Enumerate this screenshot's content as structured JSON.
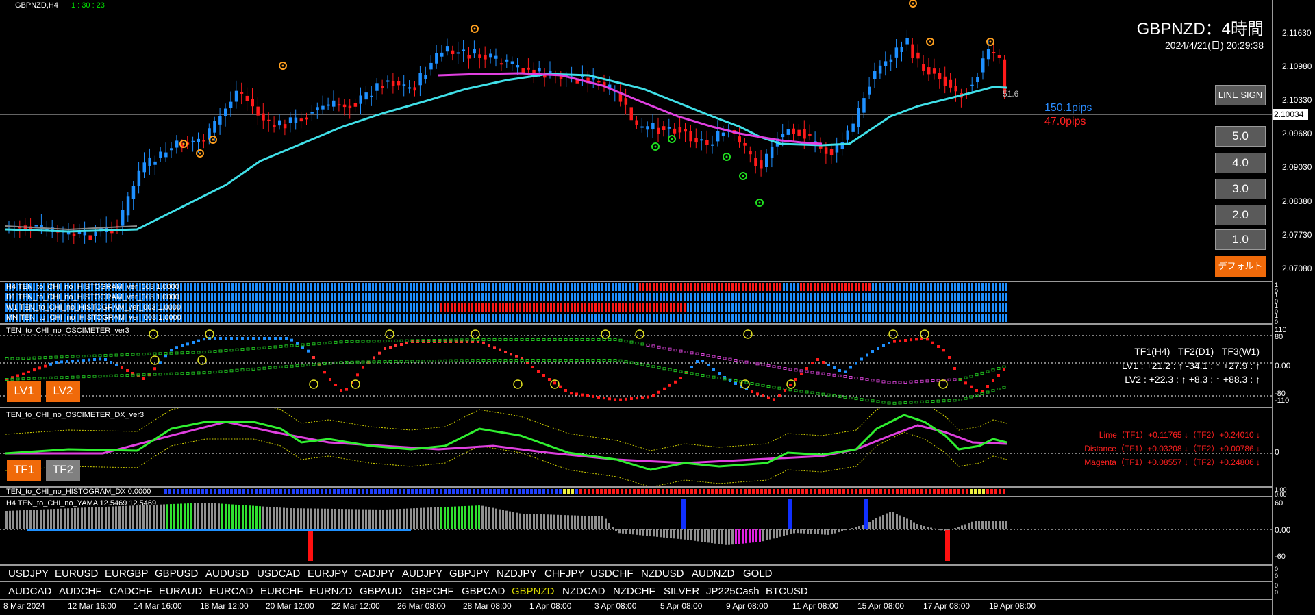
{
  "chart": {
    "symbol_period": "GBPNZD,H4",
    "countdown": "1 : 30 : 23",
    "title": "GBPNZD：4時間",
    "datetime": "2024/4/21(日) 20:29:38",
    "indicator_value": "51.6",
    "pips_blue": "150.1pips",
    "pips_red": "47.0pips",
    "current_price": "2.10034",
    "price_scale": [
      "2.11630",
      "2.10980",
      "2.10330",
      "2.09680",
      "2.09030",
      "2.08380",
      "2.07730",
      "2.07080"
    ]
  },
  "buttons": {
    "line_sign": "LINE SIGN",
    "levels": [
      "5.0",
      "4.0",
      "3.0",
      "2.0",
      "1.0"
    ],
    "default": "デフォルト",
    "lv1": "LV1",
    "lv2": "LV2",
    "tf1": "TF1",
    "tf2": "TF2"
  },
  "histogram_rows": [
    "H4 TEN_to_CHI_no_HISTOGRAM_ver_003 1.0000",
    "D1 TEN_to_CHI_no_HISTOGRAM_ver_003 1.0000",
    "W1 TEN_to_CHI_no_HISTOGRAM_ver_003 1.0000",
    "MN TEN_to_CHI_no_HISTOGRAM_ver_003 1.0000"
  ],
  "histogram_scale": [
    "1",
    "0",
    "1",
    "0",
    "1",
    "0",
    "1",
    "0"
  ],
  "oscimeter": {
    "title": "TEN_to_CHI_no_OSCIMETER_ver3",
    "scale": [
      "110",
      "80",
      "0.00",
      "-80",
      "-110"
    ],
    "table_header": [
      "TF1(H4)",
      "TF2(D1)",
      "TF3(W1)"
    ],
    "lv1": "LV1 :  +21.2  :  ↑   -34.1  :  ↑   +27.9  :  ↑",
    "lv2": "LV2 :  +22.3  :  ↑   +8.3  :  ↑   +88.3  :  ↑"
  },
  "oscimeter_dx": {
    "title": "TEN_to_CHI_no_OSCIMETER_DX_ver3",
    "scale": "0",
    "lime": "Lime（TF1）+0.11765 ↓（TF2）+0.24010 ↓",
    "distance": "Distance（TF1）+0.03208 ↓（TF2）+0.00786 ↓",
    "magenta": "Magenta（TF1）+0.08557 ↓（TF2）+0.24806 ↓"
  },
  "histogram_dx": {
    "title": "TEN_to_CHI_no_HISTOGRAM_DX 0.0000",
    "scale": [
      "1.00",
      "0.00"
    ]
  },
  "yama": {
    "title": "H4  TEN_to_CHI_no_YAMA  12.5469  12.5469",
    "scale": [
      "60",
      "0.00",
      "-60"
    ]
  },
  "symbols_row1": [
    "USDJPY",
    "EURUSD",
    "EURGBP",
    "GBPUSD",
    "AUDUSD",
    "USDCAD",
    "EURJPY",
    "CADJPY",
    "AUDJPY",
    "GBPJPY",
    "NZDJPY",
    "CHFJPY",
    "USDCHF",
    "NZDUSD",
    "AUDNZD",
    "GOLD"
  ],
  "symbols_row2": [
    "AUDCAD",
    "AUDCHF",
    "CADCHF",
    "EURAUD",
    "EURCAD",
    "EURCHF",
    "EURNZD",
    "GBPAUD",
    "GBPCHF",
    "GBPCAD",
    "GBPNZD",
    "NZDCAD",
    "NZDCHF",
    "SILVER",
    "JP225Cash",
    "BTCUSD"
  ],
  "symbol_scale": [
    "0",
    "0",
    "0",
    "0"
  ],
  "time_axis": [
    "8 Mar 2024",
    "12 Mar 16:00",
    "14 Mar 16:00",
    "18 Mar 12:00",
    "20 Mar 12:00",
    "22 Mar 12:00",
    "26 Mar 08:00",
    "28 Mar 08:00",
    "1 Apr 08:00",
    "3 Apr 08:00",
    "5 Apr 08:00",
    "9 Apr 08:00",
    "11 Apr 08:00",
    "15 Apr 08:00",
    "17 Apr 08:00",
    "19 Apr 08:00"
  ],
  "colors": {
    "bull": "#1e90ff",
    "bear": "#ff1a1a",
    "cyan_ma": "#40e0e8",
    "magenta_ma": "#e040e0",
    "active_symbol": "#d4d400",
    "button_orange": "#f06a0a"
  }
}
